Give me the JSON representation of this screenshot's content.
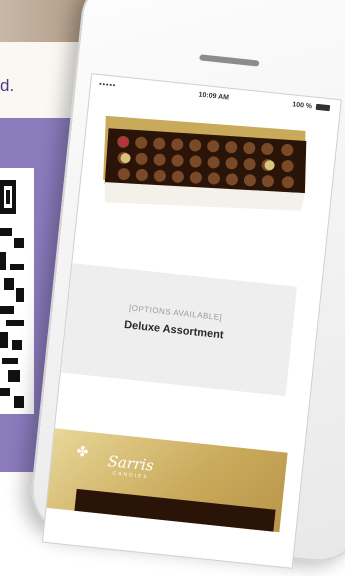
{
  "page": {
    "tagline_fragment": "d."
  },
  "phone": {
    "status": {
      "signal": "•••••",
      "time": "10:09 AM",
      "battery": "100 %"
    },
    "product": {
      "options_label": "[OPTIONS AVAILABLE]",
      "name": "Deluxe Assortment"
    },
    "brand": {
      "name": "Sarris",
      "subtitle": "CANDIES"
    }
  },
  "colors": {
    "purple_background": "#8a7bbd",
    "tagline_purple": "#4b3a83",
    "gold_box": "#c9a95a",
    "chocolate": "#5a301a"
  }
}
